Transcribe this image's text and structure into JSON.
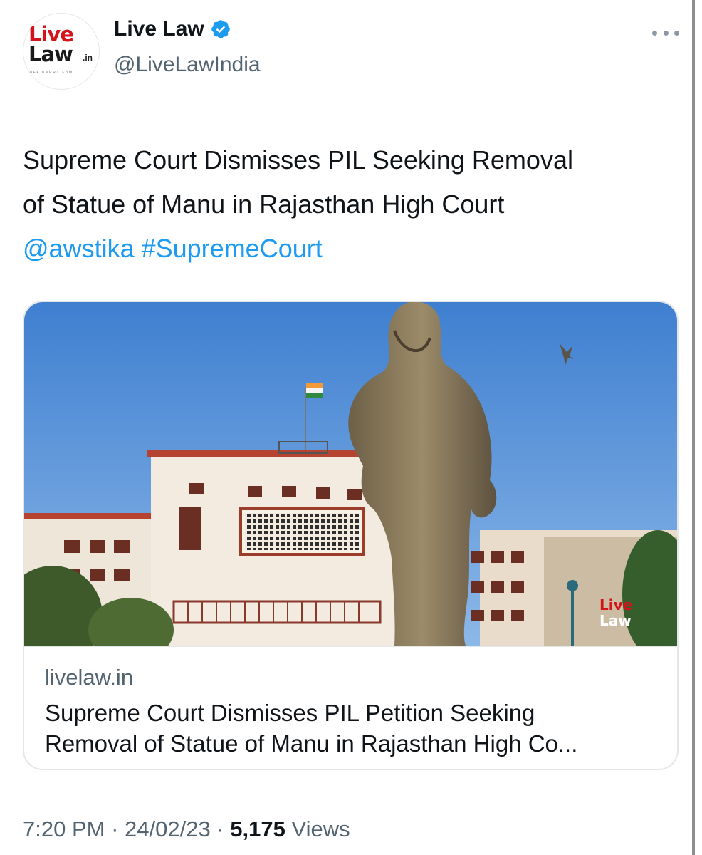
{
  "account": {
    "display_name": "Live Law",
    "handle": "@LiveLawIndia",
    "avatar": {
      "line1": "Live",
      "line2": "Law",
      "suffix": ".in",
      "tagline": "ALL ABOUT LAW"
    },
    "verified_icon": "verified-badge-icon",
    "menu_icon": "more-horizontal-icon"
  },
  "tweet": {
    "text_line1": "Supreme Court Dismisses PIL Seeking Removal",
    "text_line2": "of Statue of Manu in Rajasthan High Court",
    "mention": "@awstika",
    "hashtag": "#SupremeCourt"
  },
  "card": {
    "image_watermark": "Live Law",
    "domain": "livelaw.in",
    "title_line1": "Supreme Court Dismisses PIL Petition Seeking",
    "title_line2": "Removal of Statue of Manu in Rajasthan High Co..."
  },
  "meta": {
    "time": "7:20 PM",
    "separator": " · ",
    "date": "24/02/23",
    "views_count": "5,175",
    "views_label": "Views"
  },
  "colors": {
    "link": "#1d9bf0",
    "verified": "#1d9bf0",
    "secondary_text": "#536471",
    "brand_red": "#d4131b"
  }
}
